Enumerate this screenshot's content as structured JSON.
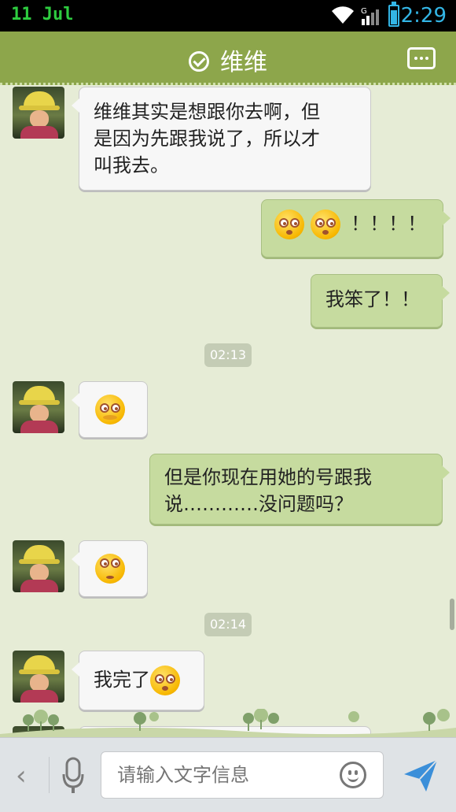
{
  "status_bar": {
    "date": "11 Jul",
    "time": "2:29",
    "network": "G"
  },
  "header": {
    "title": "维维"
  },
  "messages": [
    {
      "dir": "in",
      "lines": [
        "维维其实是想跟你去啊，但",
        "是因为先跟我说了，所以才",
        "叫我去。"
      ]
    },
    {
      "dir": "out",
      "emoji": [
        "dizzy-face",
        "dizzy-face"
      ],
      "text": "！！！！"
    },
    {
      "dir": "out",
      "text": "我笨了！！"
    },
    {
      "dir": "in",
      "emoji": [
        "hand-over-mouth-face"
      ]
    },
    {
      "dir": "out",
      "lines": [
        "但是你现在用她的号跟我",
        "说…………没问题吗？"
      ]
    },
    {
      "dir": "in",
      "emoji": [
        "eye-roll-face"
      ]
    },
    {
      "dir": "in",
      "text": "我完了",
      "emoji": [
        "dizzy-face"
      ]
    }
  ],
  "timestamps": [
    "02:13",
    "02:14"
  ],
  "input": {
    "placeholder": "请输入文字信息"
  },
  "colors": {
    "header": "#8da64b",
    "chat_bg": "#e6ecd6",
    "out_bubble": "#c6db9f",
    "in_bubble": "#f7f7f7",
    "status_time": "#33b5e5"
  }
}
